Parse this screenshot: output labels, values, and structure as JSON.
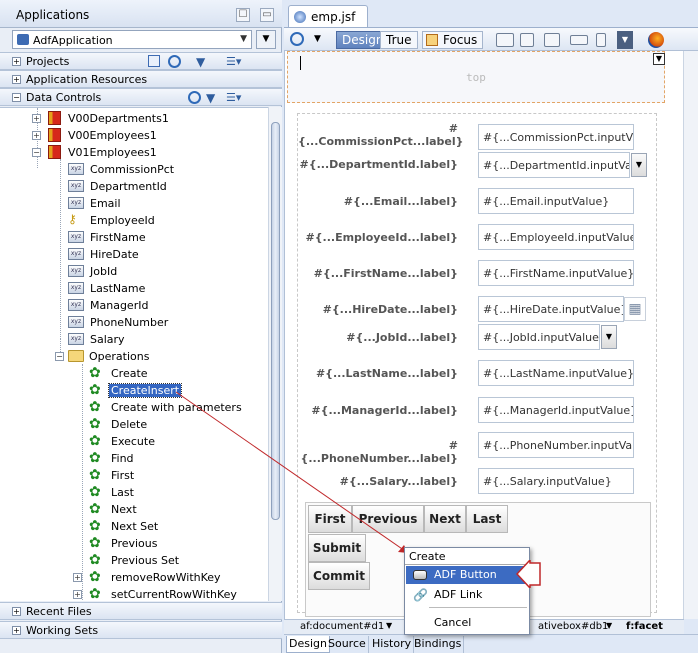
{
  "left": {
    "title": "Applications",
    "app_combo": "AdfApplication",
    "projects": "Projects",
    "app_resources": "Application Resources",
    "data_controls": "Data Controls",
    "recent_files": "Recent Files",
    "working_sets": "Working Sets",
    "tree": {
      "vo1": "V00Departments1",
      "vo2": "V00Employees1",
      "vo3": "V01Employees1",
      "attributes": [
        "CommissionPct",
        "DepartmentId",
        "Email",
        "EmployeeId",
        "FirstName",
        "HireDate",
        "JobId",
        "LastName",
        "ManagerId",
        "PhoneNumber",
        "Salary"
      ],
      "attr_icon_text": "xyz",
      "operations": "Operations",
      "ops": [
        "Create",
        "CreateInsert",
        "Create with parameters",
        "Delete",
        "Execute",
        "Find",
        "First",
        "Last",
        "Next",
        "Next Set",
        "Previous",
        "Previous Set",
        "removeRowWithKey",
        "setCurrentRowWithKey"
      ]
    }
  },
  "editor": {
    "tab": "emp.jsf",
    "toolbar": {
      "design": "Design",
      "true": "True",
      "focus": "Focus"
    },
    "top_facet": "top",
    "fields": [
      {
        "label_1": "#",
        "label_2": "{...CommissionPct...label}",
        "value": "#{...CommissionPct.inputVa"
      },
      {
        "label": "#{...DepartmentId.label}",
        "value": "#{...DepartmentId.inputValue}"
      },
      {
        "label": "#{...Email...label}",
        "value": "#{...Email.inputValue}"
      },
      {
        "label": "#{...EmployeeId...label}",
        "value": "#{...EmployeeId.inputValue"
      },
      {
        "label": "#{...FirstName...label}",
        "value": "#{...FirstName.inputValue}"
      },
      {
        "label": "#{...HireDate...label}",
        "value": "#{...HireDate.inputValue}"
      },
      {
        "label": "#{...JobId...label}",
        "value": "#{...JobId.inputValue}"
      },
      {
        "label": "#{...LastName...label}",
        "value": "#{...LastName.inputValue}"
      },
      {
        "label": "#{...ManagerId...label}",
        "value": "#{...ManagerId.inputValue}"
      },
      {
        "label": "#{...PhoneNumber...label}",
        "value": "#{...PhoneNumber.inputVal"
      },
      {
        "label": "#{...Salary...label}",
        "value": "#{...Salary.inputValue}"
      }
    ],
    "buttons": {
      "first": "First",
      "previous": "Previous",
      "next": "Next",
      "last": "Last",
      "submit": "Submit",
      "commit": "Commit"
    },
    "breadcrumb": {
      "doc": "af:document#d1",
      "box": "ativebox#db1",
      "facet": "f:facet"
    },
    "bottom_tabs": [
      "Design",
      "Source",
      "History",
      "Bindings"
    ]
  },
  "menu": {
    "header": "Create",
    "adf_button": "ADF Button",
    "adf_link": "ADF Link",
    "cancel": "Cancel"
  },
  "colors": {
    "selection": "#3466c2",
    "menu_highlight": "#3c6bc2",
    "drag_arrow": "#c0282a"
  }
}
